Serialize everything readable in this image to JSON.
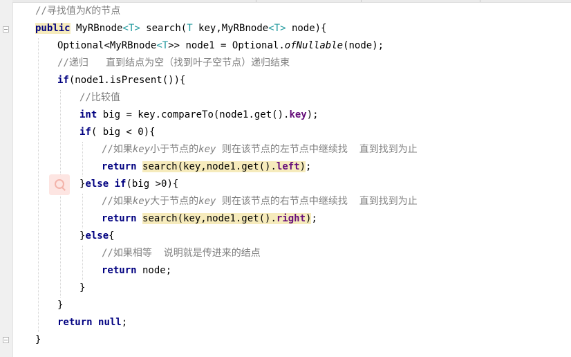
{
  "code": {
    "comment_find": "//寻找值为",
    "comment_find_k": "K",
    "comment_find_tail": "的节点",
    "kw_public": "public",
    "sig_return": " MyRBnode",
    "t": "T",
    "lt": "<",
    "gt": ">",
    "sig_name": " search(",
    "sig_param1": " key,MyRBnode",
    "sig_tail": " node){",
    "optional": "Optional",
    "myrbnode": "MyRBnode",
    "opt_decl": ">> node1 = Optional.",
    "of_nullable": "ofNullable",
    "opt_tail": "(node);",
    "comment_recursion": "//递归   直到结点为空（找到叶子空节点）递归结束",
    "kw_if": "if",
    "if_present": "(node1.isPresent()){",
    "comment_compare": "//比较值",
    "kw_int": "int",
    "compare_stmt": " big = key.compareTo(node1.get().",
    "field_key": "key",
    "compare_tail": ");",
    "if_big_lt": "( big < 0){",
    "comment_left_1": "//如果",
    "comment_key": "key",
    "comment_left_2": "小于节点的",
    "comment_left_3": " 则在该节点的左节点中继续找  直到找到为止",
    "kw_return": "return",
    "search_left": "search(key,node1.get().",
    "field_left": "left",
    "close_paren": ")",
    "semicolon": ";",
    "brace_close": "}",
    "kw_else": "else",
    "else_if_tail": "(big >0){",
    "comment_right_1": "//如果",
    "comment_right_2": "大于节点的",
    "comment_right_3": " 则在该节点的右节点中继续找  直到找到为止",
    "search_right": "search(key,node1.get().",
    "field_right": "right",
    "brace_open": "{",
    "comment_equal": "//如果相等  说明就是传进来的结点",
    "return_node": " node;",
    "kw_null": "null",
    "space": " "
  },
  "icons": {
    "gutter_fold": "fold-marker-icon",
    "intention": "search-magnifier-icon"
  },
  "colors": {
    "keyword": "#000080",
    "comment": "#808080",
    "type_param": "#20999d",
    "field": "#660e7a",
    "highlight": "#f6ebbc",
    "gutter": "#f0f0f0"
  }
}
